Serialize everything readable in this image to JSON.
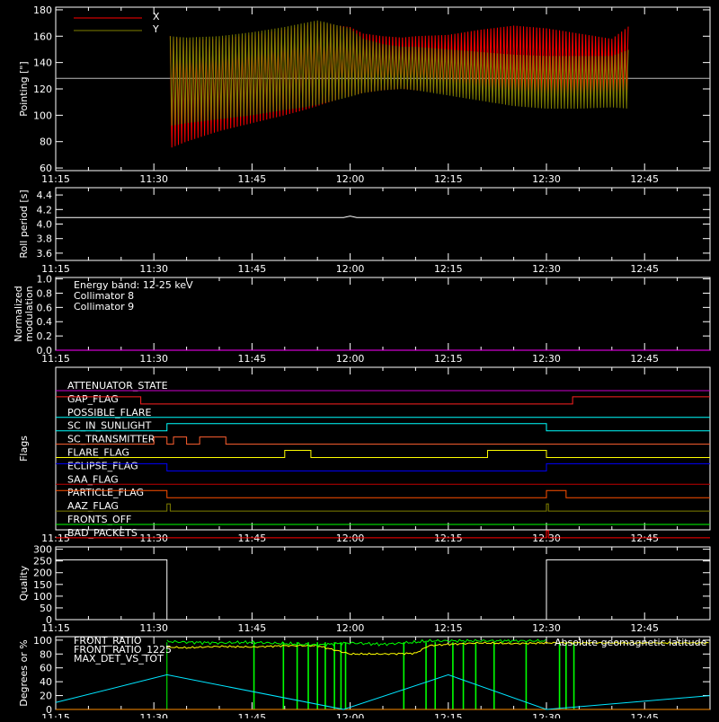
{
  "colors": {
    "background": "#000000",
    "axes": "#ffffff",
    "x_series": "#ff0000",
    "y_series": "#808000",
    "collimator8": "#00ffff",
    "collimator9": "#ff00ff",
    "front_ratio": "#ffff00",
    "front_ratio_1225": "#00ff00",
    "max_det_vs_tot": "#ff8c00",
    "geomag": "#00e5ff"
  },
  "x_axis": {
    "ticks": [
      "11:15",
      "11:30",
      "11:45",
      "12:00",
      "12:15",
      "12:30",
      "12:45"
    ],
    "tick_minutes": [
      0,
      15,
      30,
      45,
      60,
      75,
      90
    ],
    "range_minutes": [
      0,
      100
    ],
    "minor_step_minutes": 5
  },
  "chart_data": [
    {
      "type": "line",
      "ylabel": "Pointing [\"]",
      "ylim": [
        58,
        182
      ],
      "y_ticks": [
        "60",
        "80",
        "100",
        "120",
        "140",
        "160",
        "180"
      ],
      "y_tick_values": [
        60,
        80,
        100,
        120,
        140,
        160,
        180
      ],
      "reference_line": 128,
      "legend": {
        "position": "top-left"
      },
      "series": [
        {
          "name": "X",
          "data_minutes": [
            17.5,
            20,
            25,
            30,
            35,
            38,
            40,
            45,
            47,
            50,
            53,
            55,
            60,
            65,
            70,
            75,
            80,
            85,
            87.7
          ],
          "upper": [
            160,
            157,
            158,
            161,
            165,
            168,
            170,
            167,
            162,
            160,
            159,
            160,
            161,
            165,
            168,
            166,
            162,
            158,
            168
          ],
          "lower": [
            75,
            80,
            88,
            94,
            100,
            104,
            107,
            115,
            117,
            119,
            120,
            119,
            117,
            115,
            112,
            111,
            112,
            113,
            115
          ]
        },
        {
          "name": "Y",
          "data_minutes": [
            17.5,
            20,
            25,
            30,
            35,
            38,
            40,
            45,
            47,
            50,
            53,
            55,
            60,
            65,
            70,
            75,
            80,
            85,
            87.7
          ],
          "upper": [
            160,
            159,
            160,
            163,
            167,
            170,
            172,
            166,
            158,
            154,
            152,
            152,
            150,
            148,
            146,
            145,
            145,
            145,
            150
          ],
          "lower": [
            92,
            94,
            97,
            100,
            104,
            106,
            108,
            114,
            117,
            119,
            120,
            119,
            115,
            111,
            107,
            105,
            105,
            106,
            105
          ]
        }
      ]
    },
    {
      "type": "line",
      "ylabel": "Roll period [s]",
      "ylim": [
        3.5,
        4.5
      ],
      "y_ticks": [
        "3.6",
        "3.8",
        "4.0",
        "4.2",
        "4.4"
      ],
      "y_tick_values": [
        3.6,
        3.8,
        4.0,
        4.2,
        4.4
      ],
      "series": [
        {
          "x_minutes": [
            0,
            44,
            45,
            46,
            100
          ],
          "y": [
            4.09,
            4.09,
            4.11,
            4.09,
            4.09
          ]
        }
      ]
    },
    {
      "type": "line",
      "ylabel": "Normalized modulation",
      "ylim": [
        0,
        1.02
      ],
      "y_ticks": [
        "0.0",
        "0.2",
        "0.4",
        "0.6",
        "0.8",
        "1.0"
      ],
      "y_tick_values": [
        0,
        0.2,
        0.4,
        0.6,
        0.8,
        1.0
      ],
      "legend_title": "Energy band: 12-25 keV",
      "series": [
        {
          "name": "Collimator 8",
          "x_minutes": [
            0,
            100
          ],
          "y": [
            0,
            0
          ]
        },
        {
          "name": "Collimator 9",
          "x_minutes": [
            0,
            100
          ],
          "y": [
            0,
            0
          ]
        }
      ]
    },
    {
      "type": "line",
      "ylabel": "Flags",
      "flags": [
        {
          "name": "ATTENUATOR_STATE",
          "color": "#cc00cc",
          "steps": [
            [
              0,
              0
            ]
          ]
        },
        {
          "name": "GAP_FLAG",
          "color": "#ff2020",
          "steps": [
            [
              0,
              1
            ],
            [
              13,
              0
            ],
            [
              79,
              1
            ]
          ]
        },
        {
          "name": "POSSIBLE_FLARE",
          "color": "#00ffff",
          "steps": [
            [
              0,
              0
            ]
          ]
        },
        {
          "name": "SC_IN_SUNLIGHT",
          "color": "#00ffff",
          "steps": [
            [
              0,
              0
            ],
            [
              17,
              1
            ],
            [
              75,
              0
            ]
          ]
        },
        {
          "name": "SC_TRANSMITTER",
          "color": "#ff6030",
          "steps": [
            [
              0,
              0
            ],
            [
              15,
              1
            ],
            [
              17,
              0
            ],
            [
              18,
              1
            ],
            [
              20,
              0
            ],
            [
              22,
              1
            ],
            [
              26,
              0
            ]
          ]
        },
        {
          "name": "FLARE_FLAG",
          "color": "#ffff00",
          "steps": [
            [
              0,
              0
            ],
            [
              35,
              1
            ],
            [
              39,
              0
            ],
            [
              66,
              1
            ],
            [
              75,
              0
            ]
          ]
        },
        {
          "name": "ECLIPSE_FLAG",
          "color": "#0000ff",
          "steps": [
            [
              0,
              1
            ],
            [
              17,
              0
            ],
            [
              75,
              1
            ]
          ]
        },
        {
          "name": "SAA_FLAG",
          "color": "#c00000",
          "steps": [
            [
              0,
              0
            ]
          ]
        },
        {
          "name": "PARTICLE_FLAG",
          "color": "#ff5000",
          "steps": [
            [
              0,
              1
            ],
            [
              13,
              1
            ],
            [
              17,
              0
            ],
            [
              75,
              1
            ],
            [
              78,
              0
            ]
          ]
        },
        {
          "name": "AAZ_FLAG",
          "color": "#808000",
          "steps": [
            [
              0,
              0
            ],
            [
              17,
              1
            ],
            [
              17.5,
              0
            ],
            [
              75,
              1
            ],
            [
              75.3,
              0
            ]
          ]
        },
        {
          "name": "FRONTS_OFF",
          "color": "#00ff00",
          "steps": [
            [
              0,
              0
            ]
          ]
        },
        {
          "name": "BAD_PACKETS",
          "color": "#ff0000",
          "steps": [
            [
              0,
              0
            ],
            [
              75,
              1
            ],
            [
              75.3,
              0
            ]
          ]
        }
      ]
    },
    {
      "type": "line",
      "ylabel": "Quality",
      "ylim": [
        0,
        310
      ],
      "y_ticks": [
        "0",
        "50",
        "100",
        "150",
        "200",
        "250",
        "300"
      ],
      "y_tick_values": [
        0,
        50,
        100,
        150,
        200,
        250,
        300
      ],
      "series": [
        {
          "x_minutes": [
            0,
            17,
            17,
            75,
            75,
            100
          ],
          "y": [
            255,
            255,
            0,
            0,
            255,
            255
          ]
        }
      ]
    },
    {
      "type": "line",
      "ylabel": "Degrees or %",
      "ylim": [
        0,
        105
      ],
      "y_ticks": [
        "0",
        "20",
        "40",
        "60",
        "80",
        "100"
      ],
      "y_tick_values": [
        0,
        20,
        40,
        60,
        80,
        100
      ],
      "series": [
        {
          "name": "FRONT_RATIO",
          "x_minutes": [
            17,
            20,
            25,
            30,
            35,
            40,
            45,
            50,
            55,
            57,
            60,
            65,
            70,
            75,
            80,
            85,
            90,
            100
          ],
          "y": [
            90,
            89,
            91,
            90,
            92,
            92,
            80,
            80,
            81,
            92,
            94,
            96,
            95,
            96,
            96,
            96,
            96,
            96
          ]
        },
        {
          "name": "FRONT_RATIO_1225",
          "x_minutes": [
            17,
            20,
            25,
            30,
            35,
            40,
            45,
            50,
            55,
            57,
            60,
            65,
            70,
            75
          ],
          "y": [
            98,
            97,
            96,
            97,
            95,
            93,
            96,
            94,
            97,
            99,
            99,
            99,
            99,
            99
          ]
        },
        {
          "name": "MAX_DET_VS_TOT",
          "x_minutes": [
            0,
            100
          ],
          "y": [
            0,
            0
          ]
        },
        {
          "name": "Absolute geomagnetic latitude",
          "x_minutes": [
            0,
            17,
            44,
            60,
            75,
            100
          ],
          "y": [
            10,
            50,
            0,
            50,
            0,
            20
          ]
        }
      ]
    }
  ]
}
